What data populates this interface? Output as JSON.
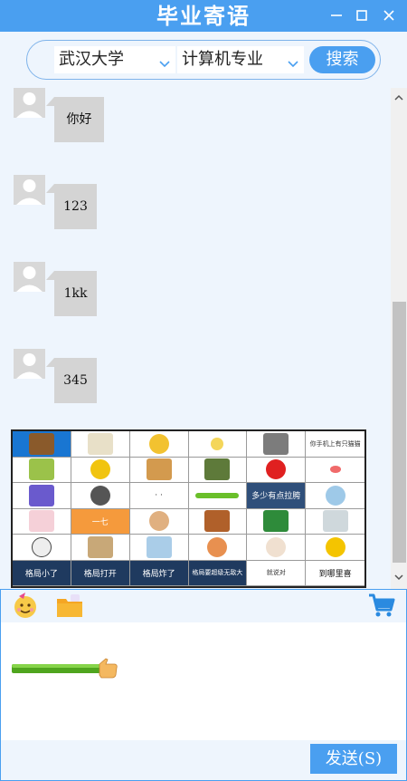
{
  "window": {
    "title": "毕业寄语"
  },
  "search": {
    "university": "武汉大学",
    "major": "计算机专业",
    "button_label": "搜索"
  },
  "messages": [
    {
      "text": "你好"
    },
    {
      "text": "123"
    },
    {
      "text": "1kk"
    },
    {
      "text": "345"
    }
  ],
  "stickers": {
    "captions": {
      "r0c5": "你手机上有只猫猫",
      "r2c2": "· ·",
      "r2c4": "多少有点拉胯",
      "r3c1": "一七",
      "r5c0": "格局小了",
      "r5c1": "格局打开",
      "r5c2": "格局炸了",
      "r5c3": "格局要超级无敌大",
      "r5c4": "就说对",
      "r5c5": "到哪里喜"
    }
  },
  "composer": {
    "send_label": "发送(S)"
  },
  "colors": {
    "accent": "#4a9ff0",
    "background": "#eef5fd",
    "bubble": "#d4d4d4"
  }
}
